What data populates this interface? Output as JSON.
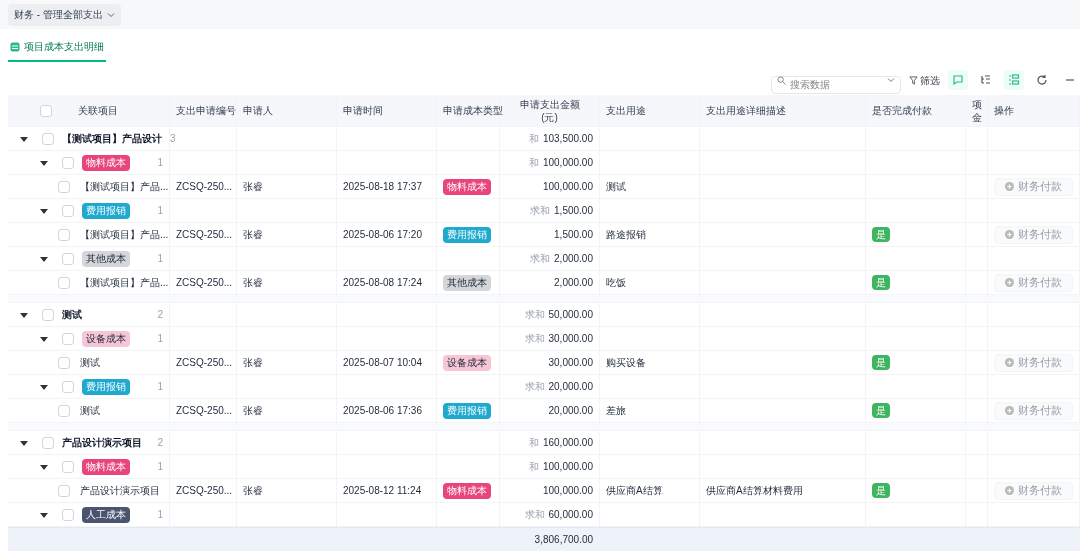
{
  "view_switcher": {
    "label": "财务 - 管理全部支出"
  },
  "tabs": [
    {
      "label": "项目成本支出明细",
      "selected": true
    }
  ],
  "toolbar": {
    "search": {
      "placeholder": "搜索数据"
    },
    "filter": {
      "label": "筛选"
    },
    "icons": [
      {
        "kind": "comment",
        "active": true
      },
      {
        "kind": "tree",
        "active": false
      },
      {
        "kind": "group",
        "active": true
      },
      {
        "kind": "refresh",
        "active": false
      },
      {
        "kind": "more",
        "active": false
      }
    ]
  },
  "table": {
    "columns": [
      {
        "lines": [
          "关联项目"
        ]
      },
      {
        "lines": [
          "支出申请编号"
        ]
      },
      {
        "lines": [
          "申请人"
        ]
      },
      {
        "lines": [
          "申请时间"
        ]
      },
      {
        "lines": [
          "申请成本类型"
        ]
      },
      {
        "lines": [
          "申请支出金额",
          "(元)"
        ]
      },
      {
        "lines": [
          "支出用途"
        ]
      },
      {
        "lines": [
          "支出用途详细描述"
        ]
      },
      {
        "lines": [
          "是否完成付款"
        ]
      },
      {
        "lines": [
          "项",
          "金"
        ]
      },
      {
        "lines": [
          "操作"
        ]
      }
    ],
    "header_checkbox": {
      "checked": false
    },
    "groups": [
      {
        "name": "【测试项目】产品设计",
        "count": "3",
        "expanded": true,
        "checked": false,
        "sum_label": "和",
        "sum": "103,500.00",
        "subgroups": [
          {
            "tag": {
              "label": "物料成本",
              "color": "#e8457a",
              "kind": "solid"
            },
            "count": "1",
            "expanded": true,
            "checked": false,
            "sum_label": "和",
            "sum": "100,000.00",
            "rows": [
              {
                "checked": false,
                "project": "【测试项目】产品...",
                "code": "ZCSQ-250...",
                "applicant": "张睿",
                "time": "2025-08-18 17:37",
                "tag": {
                  "label": "物料成本",
                  "color": "#e8457a",
                  "kind": "solid"
                },
                "amount": "100,000.00",
                "purpose": "测试",
                "action": {
                  "label": "财务付款",
                  "disabled": true
                }
              }
            ]
          },
          {
            "tag": {
              "label": "费用报销",
              "color": "#1fa9cf",
              "kind": "solid"
            },
            "count": "1",
            "expanded": true,
            "checked": false,
            "sum_label": "求和",
            "sum": "1,500.00",
            "rows": [
              {
                "checked": false,
                "project": "【测试项目】产品...",
                "code": "ZCSQ-250...",
                "applicant": "张睿",
                "time": "2025-08-06 17:20",
                "tag": {
                  "label": "费用报销",
                  "color": "#1fa9cf",
                  "kind": "solid"
                },
                "amount": "1,500.00",
                "purpose": "路途报销",
                "paid": "是",
                "action": {
                  "label": "财务付款",
                  "disabled": true
                }
              }
            ]
          },
          {
            "tag": {
              "label": "其他成本",
              "color": "#d4d6da",
              "kind": "light"
            },
            "count": "1",
            "expanded": true,
            "checked": false,
            "sum_label": "求和",
            "sum": "2,000.00",
            "rows": [
              {
                "checked": false,
                "project": "【测试项目】产品...",
                "code": "ZCSQ-250...",
                "applicant": "张睿",
                "time": "2025-08-08 17:24",
                "tag": {
                  "label": "其他成本",
                  "color": "#d4d6da",
                  "kind": "light"
                },
                "amount": "2,000.00",
                "purpose": "吃饭",
                "paid": "是",
                "action": {
                  "label": "财务付款",
                  "disabled": true
                }
              }
            ]
          }
        ]
      },
      {
        "name": "测试",
        "count": "2",
        "expanded": true,
        "checked": false,
        "sum_label": "求和",
        "sum": "50,000.00",
        "subgroups": [
          {
            "tag": {
              "label": "设备成本",
              "color": "#f7c6d6",
              "kind": "light"
            },
            "count": "1",
            "expanded": true,
            "checked": false,
            "sum_label": "求和",
            "sum": "30,000.00",
            "rows": [
              {
                "checked": false,
                "project": "测试",
                "code": "ZCSQ-250...",
                "applicant": "张睿",
                "time": "2025-08-07 10:04",
                "tag": {
                  "label": "设备成本",
                  "color": "#f7c6d6",
                  "kind": "light"
                },
                "amount": "30,000.00",
                "purpose": "购买设备",
                "paid": "是",
                "action": {
                  "label": "财务付款",
                  "disabled": true
                }
              }
            ]
          },
          {
            "tag": {
              "label": "费用报销",
              "color": "#1fa9cf",
              "kind": "solid"
            },
            "count": "1",
            "expanded": true,
            "checked": false,
            "sum_label": "求和",
            "sum": "20,000.00",
            "rows": [
              {
                "checked": false,
                "project": "测试",
                "code": "ZCSQ-250...",
                "applicant": "张睿",
                "time": "2025-08-06 17:36",
                "tag": {
                  "label": "费用报销",
                  "color": "#1fa9cf",
                  "kind": "solid"
                },
                "amount": "20,000.00",
                "purpose": "差旅",
                "paid": "是",
                "action": {
                  "label": "财务付款",
                  "disabled": true
                }
              }
            ]
          }
        ]
      },
      {
        "name": "产品设计演示项目",
        "count": "2",
        "expanded": true,
        "checked": false,
        "sum_label": "和",
        "sum": "160,000.00",
        "subgroups": [
          {
            "tag": {
              "label": "物料成本",
              "color": "#e8457a",
              "kind": "solid"
            },
            "count": "1",
            "expanded": true,
            "checked": false,
            "sum_label": "和",
            "sum": "100,000.00",
            "rows": [
              {
                "checked": false,
                "project": "产品设计演示项目",
                "code": "ZCSQ-250...",
                "applicant": "张睿",
                "time": "2025-08-12 11:24",
                "tag": {
                  "label": "物料成本",
                  "color": "#e8457a",
                  "kind": "solid"
                },
                "amount": "100,000.00",
                "purpose": "供应商A结算",
                "description": "供应商A结算材料费用",
                "paid": "是",
                "action": {
                  "label": "财务付款",
                  "disabled": true
                }
              }
            ]
          },
          {
            "tag": {
              "label": "人工成本",
              "color": "#4a5470",
              "kind": "solid"
            },
            "count": "1",
            "expanded": true,
            "checked": false,
            "sum_label": "求和",
            "sum": "60,000.00"
          }
        ]
      }
    ],
    "total": {
      "sum": "3,806,700.00"
    }
  }
}
